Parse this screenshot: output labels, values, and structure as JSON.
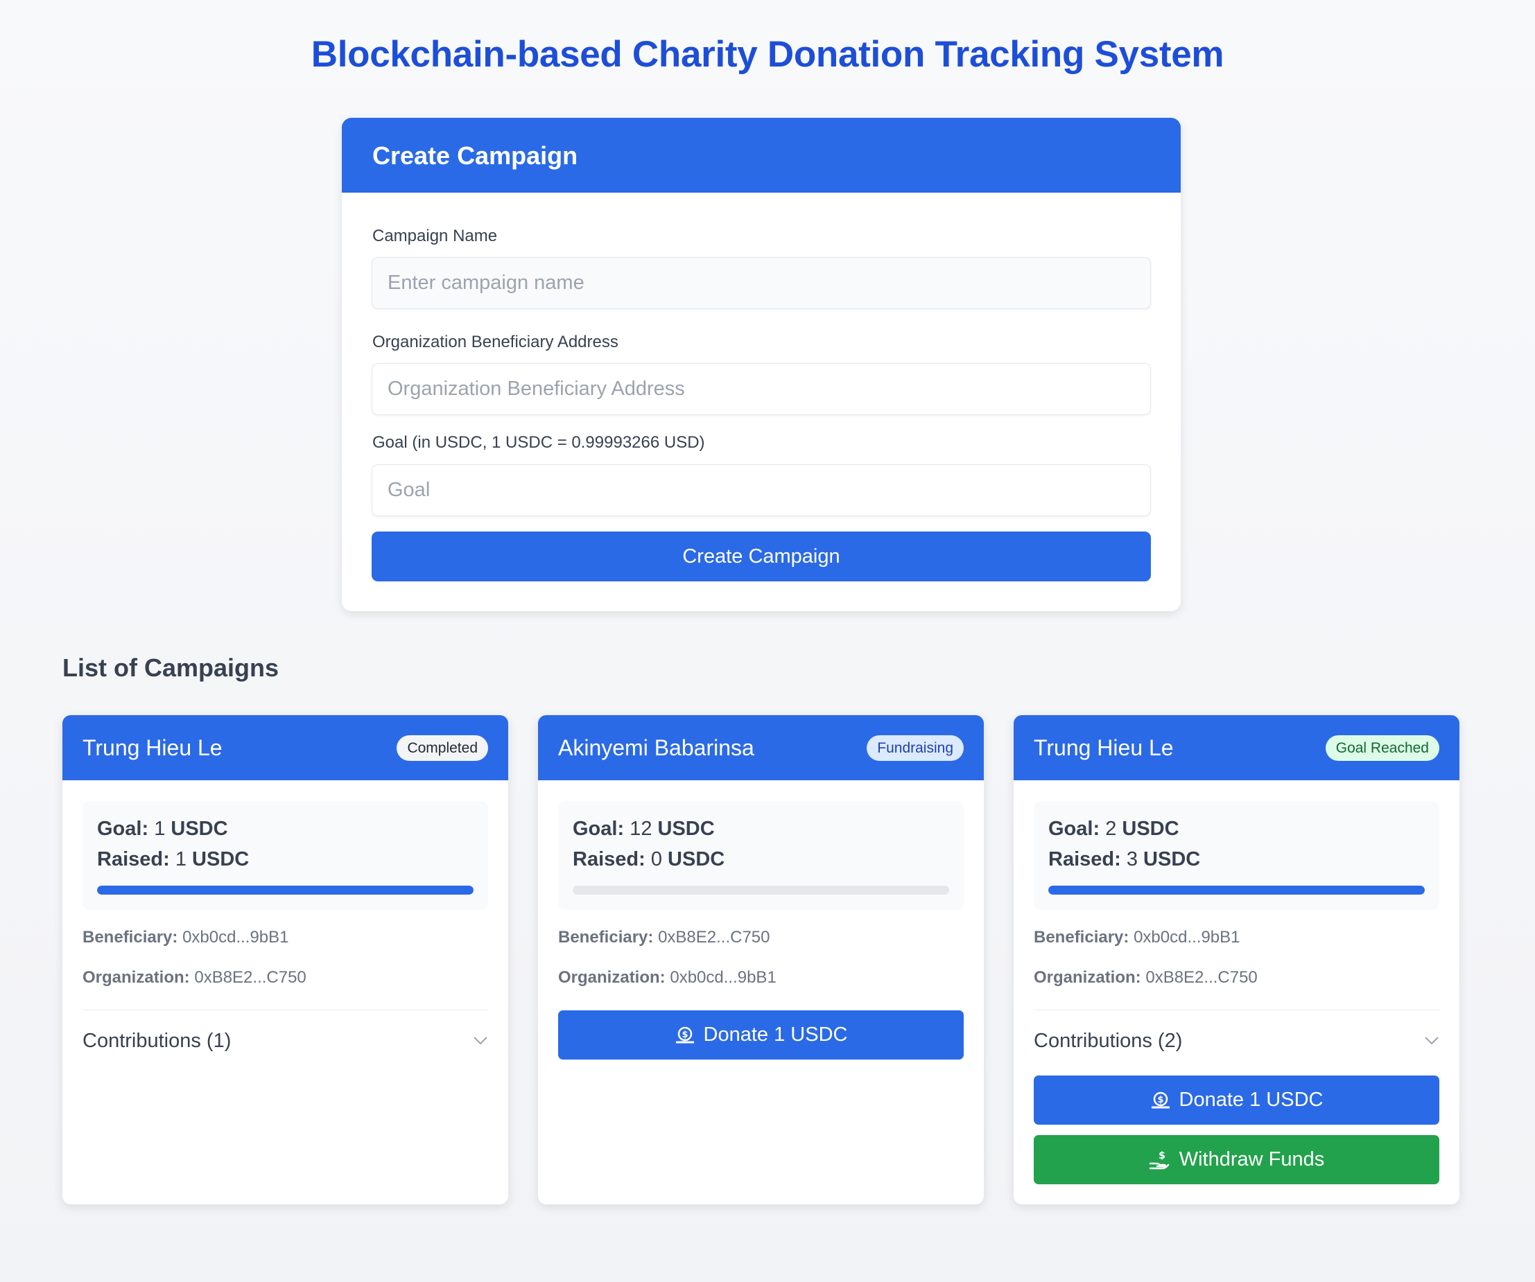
{
  "page": {
    "title": "Blockchain-based Charity Donation Tracking System"
  },
  "create_form": {
    "header": "Create Campaign",
    "name_label": "Campaign Name",
    "name_placeholder": "Enter campaign name",
    "address_label": "Organization Beneficiary Address",
    "address_placeholder": "Organization Beneficiary Address",
    "goal_label": "Goal (in USDC, 1 USDC = 0.99993266 USD)",
    "goal_placeholder": "Goal",
    "submit_label": "Create Campaign"
  },
  "list": {
    "title": "List of Campaigns"
  },
  "labels": {
    "goal": "Goal:",
    "raised": "Raised:",
    "unit": "USDC",
    "beneficiary": "Beneficiary:",
    "organization": "Organization:"
  },
  "campaigns": [
    {
      "name": "Trung Hieu Le",
      "status": "Completed",
      "goal": "1",
      "raised": "1",
      "progress": 1.0,
      "beneficiary": "0xb0cd...9bB1",
      "organization": "0xB8E2...C750",
      "contributions_label": "Contributions (1)"
    },
    {
      "name": "Akinyemi Babarinsa",
      "status": "Fundraising",
      "goal": "12",
      "raised": "0",
      "progress": 0.0,
      "beneficiary": "0xB8E2...C750",
      "organization": "0xb0cd...9bB1",
      "donate_label": "Donate 1 USDC"
    },
    {
      "name": "Trung Hieu Le",
      "status": "Goal Reached",
      "goal": "2",
      "raised": "3",
      "progress": 1.0,
      "beneficiary": "0xb0cd...9bB1",
      "organization": "0xB8E2...C750",
      "contributions_label": "Contributions (2)",
      "donate_label": "Donate 1 USDC",
      "withdraw_label": "Withdraw Funds"
    }
  ],
  "colors": {
    "primary": "#2b6ae6",
    "title": "#1d4ed8",
    "success": "#22a24c"
  }
}
